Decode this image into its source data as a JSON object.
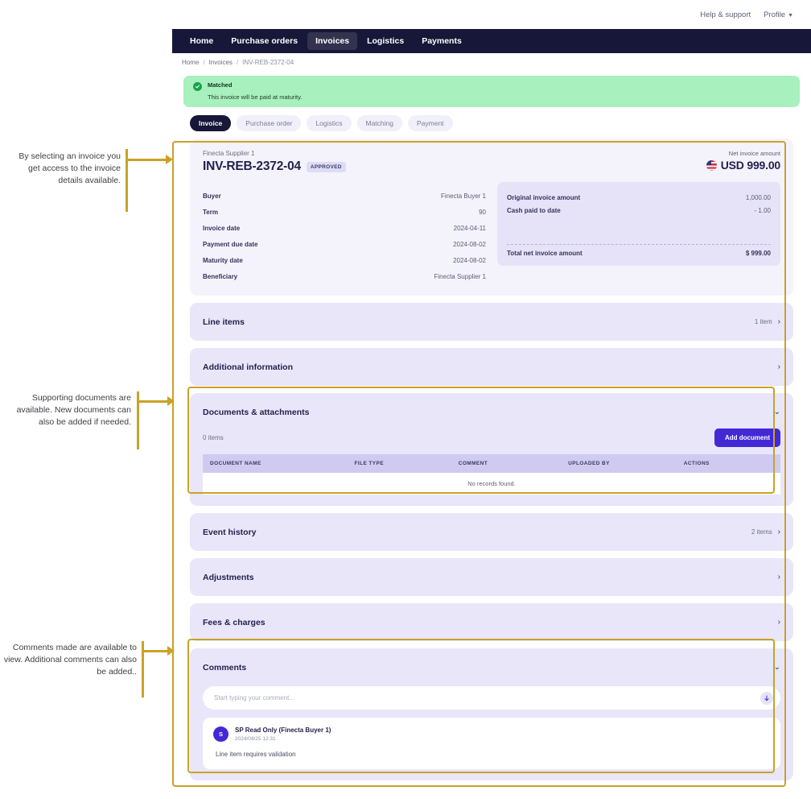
{
  "utility_bar": {
    "help": "Help & support",
    "profile": "Profile"
  },
  "nav": {
    "items": [
      {
        "label": "Home",
        "active": false
      },
      {
        "label": "Purchase orders",
        "active": false
      },
      {
        "label": "Invoices",
        "active": true
      },
      {
        "label": "Logistics",
        "active": false
      },
      {
        "label": "Payments",
        "active": false
      }
    ]
  },
  "breadcrumb": {
    "home": "Home",
    "invoices": "Invoices",
    "current": "INV-REB-2372-04",
    "separator": "/"
  },
  "banner": {
    "title": "Matched",
    "subtitle": "This invoice will be paid at maturity."
  },
  "tabs": [
    {
      "label": "Invoice",
      "active": true
    },
    {
      "label": "Purchase order",
      "active": false
    },
    {
      "label": "Logistics",
      "active": false
    },
    {
      "label": "Matching",
      "active": false
    },
    {
      "label": "Payment",
      "active": false
    }
  ],
  "invoice": {
    "supplier": "Finecta Supplier 1",
    "number": "INV-REB-2372-04",
    "status_badge": "APPROVED",
    "fields": [
      {
        "key": "Buyer",
        "value": "Finecta Buyer 1"
      },
      {
        "key": "Term",
        "value": "90"
      },
      {
        "key": "Invoice date",
        "value": "2024-04-11"
      },
      {
        "key": "Payment due date",
        "value": "2024-08-02"
      },
      {
        "key": "Maturity date",
        "value": "2024-08-02"
      },
      {
        "key": "Beneficiary",
        "value": "Finecta Supplier 1"
      }
    ],
    "net": {
      "label": "Net invoice amount",
      "amount": "USD 999.00",
      "currency_flag": "us-flag-icon"
    },
    "amounts": [
      {
        "key": "Original invoice amount",
        "value": "1,000.00"
      },
      {
        "key": "Cash paid to date",
        "value": "- 1.00"
      }
    ],
    "total": {
      "key": "Total net invoice amount",
      "value": "$ 999.00"
    }
  },
  "sections": {
    "line_items": {
      "title": "Line items",
      "count": "1 item"
    },
    "additional_information": {
      "title": "Additional information",
      "count": ""
    },
    "documents": {
      "title": "Documents & attachments",
      "items_count": "0 items",
      "add_button": "Add document",
      "columns": [
        "DOCUMENT NAME",
        "FILE TYPE",
        "COMMENT",
        "UPLOADED BY",
        "ACTIONS"
      ],
      "empty_message": "No records found."
    },
    "event_history": {
      "title": "Event history",
      "count": "2 items"
    },
    "adjustments": {
      "title": "Adjustments",
      "count": ""
    },
    "fees_charges": {
      "title": "Fees & charges",
      "count": ""
    },
    "comments": {
      "title": "Comments",
      "input_placeholder": "Start typing your comment...",
      "entries": [
        {
          "initial": "S",
          "author": "SP Read Only (Finecta Buyer 1)",
          "timestamp": "2024/04/25 12:31",
          "body": "Line item requires validation"
        }
      ]
    }
  },
  "annotations": [
    {
      "id": "invoice-details",
      "text": "By selecting an invoice you get access to the invoice details available."
    },
    {
      "id": "documents",
      "text": "Supporting documents are available. New documents can also be added if needed."
    },
    {
      "id": "comments",
      "text": "Comments made are available to view. Additional comments can also be added.."
    }
  ],
  "colors": {
    "nav_bg": "#171739",
    "banner_bg": "#a8f0bd",
    "accent": "#4329d6",
    "card_bg": "#f4f3fc",
    "section_bg": "#e9e6fa",
    "annotation": "#c9a227"
  }
}
